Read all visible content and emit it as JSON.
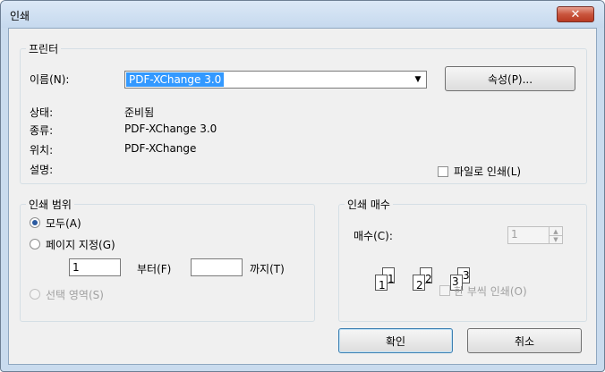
{
  "window": {
    "title": "인쇄",
    "close_icon": "close-icon"
  },
  "printer": {
    "group_title": "프린터",
    "name_label": "이름(N):",
    "name_value": "PDF-XChange 3.0",
    "properties_button": "속성(P)...",
    "status_label": "상태:",
    "status_value": "준비됨",
    "type_label": "종류:",
    "type_value": "PDF-XChange 3.0",
    "where_label": "위치:",
    "where_value": "PDF-XChange",
    "comment_label": "설명:",
    "print_to_file": "파일로 인쇄(L)",
    "print_to_file_checked": false
  },
  "range": {
    "group_title": "인쇄 범위",
    "all_label": "모두(A)",
    "pages_label": "페이지 지정(G)",
    "from_value": "1",
    "from_label": "부터(F)",
    "to_value": "",
    "to_label": "까지(T)",
    "selection_label": "선택 영역(S)",
    "selected": "all"
  },
  "copies": {
    "group_title": "인쇄 매수",
    "count_label": "매수(C):",
    "count_value": "1",
    "collate_label": "한 부씩 인쇄(O)",
    "collate_checked": false,
    "collate_pages": [
      "1",
      "1",
      "2",
      "2",
      "3",
      "3"
    ]
  },
  "buttons": {
    "ok": "확인",
    "cancel": "취소"
  },
  "colors": {
    "accent": "#3399ff",
    "close": "#c9553d",
    "frame": "#c9dbee"
  }
}
